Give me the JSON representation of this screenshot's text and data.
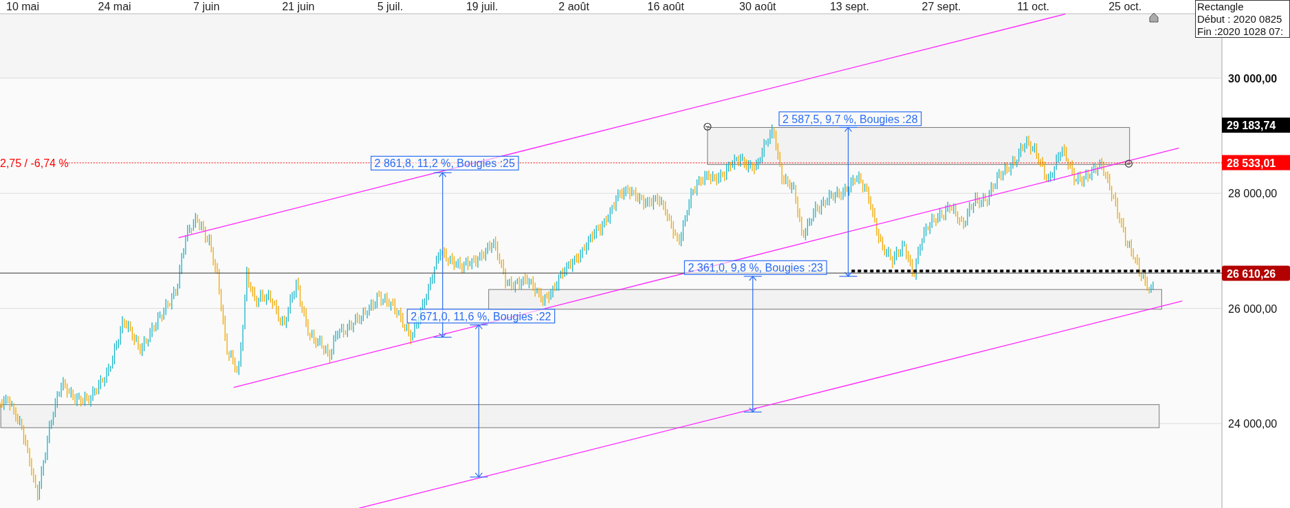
{
  "x_axis": {
    "labels": [
      "10 mai",
      "24 mai",
      "7 juin",
      "21 juin",
      "5 juil.",
      "19 juil.",
      "2 août",
      "16 août",
      "30 août",
      "13 sept.",
      "27 sept.",
      "11 oct.",
      "25 oct."
    ]
  },
  "y_axis": {
    "labels": [
      {
        "label": "30 000,00",
        "bold": true
      },
      {
        "label": "28 000,00",
        "bold": false
      },
      {
        "label": "26 000,00",
        "bold": false
      },
      {
        "label": "24 000,00",
        "bold": false
      }
    ]
  },
  "price_tags": [
    {
      "label": "29 183,74",
      "color": "#000000"
    },
    {
      "label": "28 533,01",
      "color": "#ff0000"
    },
    {
      "label": "26 610,26",
      "color": "#b30000"
    }
  ],
  "level_line": {
    "label": "2,75 / -6,74 %"
  },
  "measurements": [
    {
      "label": "2 861,8, 11,2 %, Bougies :25"
    },
    {
      "label": "2 587,5, 9,7 %, Bougies :28"
    },
    {
      "label": "2 361,0, 9,8 %, Bougies :23"
    },
    {
      "label": "2 671,0, 11,6 %, Bougies :22"
    }
  ],
  "info_box": {
    "lines": [
      "Rectangle",
      "Début : 2020 0825",
      "Fin :2020 1028 07:"
    ]
  }
}
